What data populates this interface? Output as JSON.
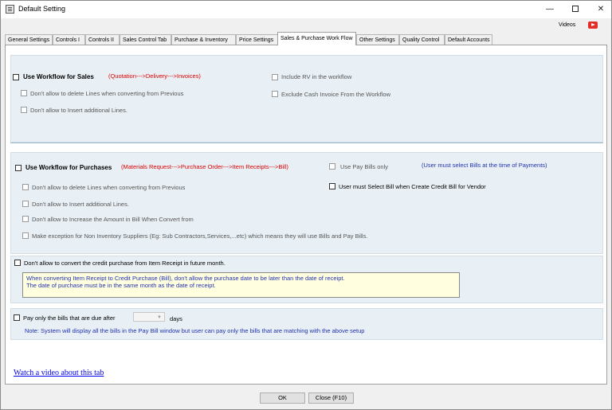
{
  "window": {
    "title": "Default Setting",
    "controls": {
      "minimize": "—",
      "close": "✕"
    }
  },
  "header": {
    "videos_label": "Videos"
  },
  "tabs": [
    {
      "label": "General Settings"
    },
    {
      "label": "Controls I"
    },
    {
      "label": "Controls II"
    },
    {
      "label": "Sales Control Tab"
    },
    {
      "label": "Purchase & Inventory"
    },
    {
      "label": "Price Settings"
    },
    {
      "label": "Sales & Purchase Work Flow",
      "active": true
    },
    {
      "label": "Other Settings"
    },
    {
      "label": "Quality Control"
    },
    {
      "label": "Default Accounts"
    }
  ],
  "sales": {
    "use_workflow": "Use Workflow for Sales",
    "flow": "(Quotation--->Delivery--->Invoices)",
    "no_delete_lines": "Don't allow to delete Lines when converting from Previous",
    "no_insert_lines": "Don't allow to Insert additional Lines.",
    "include_rv": "Include RV in the workflow",
    "exclude_cash": "Exclude Cash Invoice From the Workflow"
  },
  "purchases": {
    "use_workflow": "Use Workflow for Purchases",
    "flow": "(Materials Request--->Purchase Order--->Item Receipts--->Bill)",
    "use_pay_bills": "Use Pay Bills only",
    "pay_bills_note": "(User must select Bills at the time of Payments)",
    "must_select_bill": "User must Select Bill when Create Credit Bill for Vendor",
    "no_delete_lines": "Don't allow to delete Lines when converting from Previous",
    "no_insert_lines": "Don't allow to Insert additional Lines.",
    "no_increase_amount": "Don't allow to Increase the Amount in Bill When Convert from",
    "exception_non_inventory": "Make exception for Non Inventory Suppliers (Eg: Sub Contractors,Services,...etc) which means they will use Bills and Pay Bills."
  },
  "credit_purchase": {
    "label": "Don't allow to convert the credit purchase from Item Receipt in future month.",
    "note_line1": "When converting Item Receipt to Credit Purchase (Bill), don't allow the purchase date to be later than the date of receipt.",
    "note_line2": "The date of purchase must be in the same month as the date of receipt."
  },
  "pay_bills_due": {
    "label": "Pay only the bills that are due after",
    "days_label": "days",
    "days_value": "",
    "note": "Note: System will display all the bills in the Pay Bill window but user can pay only the bills that are matching with the above setup"
  },
  "footer": {
    "video_link": "Watch a video about this tab",
    "ok_label": "OK",
    "close_label": "Close (F10)"
  }
}
